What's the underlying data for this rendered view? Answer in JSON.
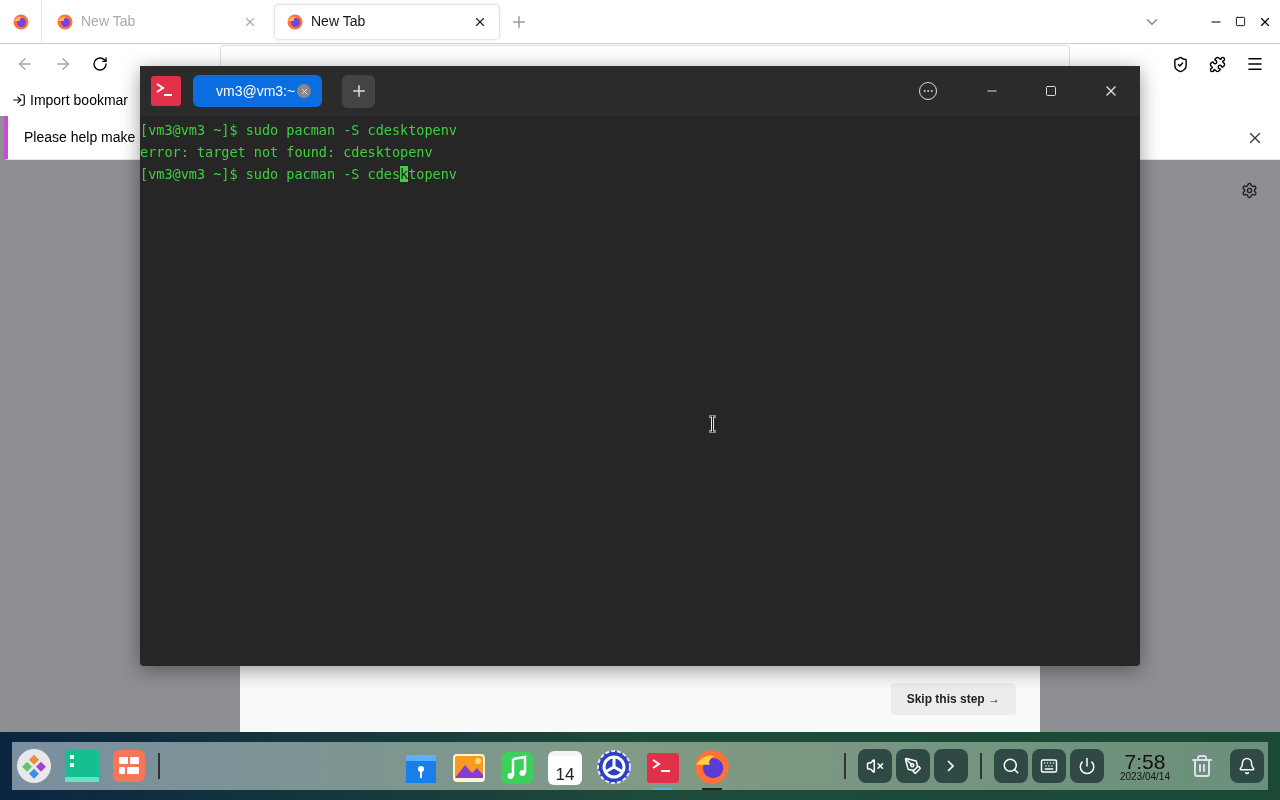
{
  "browser": {
    "tabs": [
      {
        "label": "New Tab",
        "selected": false
      },
      {
        "label": "New Tab",
        "selected": true
      }
    ],
    "bookmarks": [
      {
        "label": "Import bookmar"
      }
    ],
    "notice": {
      "text": "Please help make"
    },
    "skip_button": {
      "label": "Skip this step →"
    }
  },
  "terminal": {
    "tabs": [
      {
        "label": "vm3@vm3:~",
        "selected": true
      }
    ],
    "lines": [
      {
        "text": "[vm3@vm3 ~]$ sudo pacman -S cdesktopenv"
      },
      {
        "text": "error: target not found: cdesktopenv"
      },
      {
        "text_before_cursor": "[vm3@vm3 ~]$ sudo pacman -S cdes",
        "cursor_char": "k",
        "text_after_cursor": "topenv"
      }
    ]
  },
  "dock": {
    "left": [
      {
        "kind": "launcher"
      },
      {
        "kind": "files-green"
      },
      {
        "kind": "multitask"
      }
    ],
    "apps": [
      {
        "kind": "file-manager",
        "running": false
      },
      {
        "kind": "photos",
        "running": false
      },
      {
        "kind": "music",
        "running": false
      },
      {
        "kind": "calendar",
        "label": "14",
        "running": false
      },
      {
        "kind": "settings",
        "running": false
      },
      {
        "kind": "terminal",
        "running": true
      },
      {
        "kind": "firefox",
        "running": true
      }
    ],
    "tray": [
      {
        "kind": "mute"
      },
      {
        "kind": "pen"
      },
      {
        "kind": "chevron"
      }
    ],
    "tray2": [
      {
        "kind": "search"
      },
      {
        "kind": "keyboard"
      },
      {
        "kind": "power"
      }
    ],
    "clock": {
      "time": "7:58",
      "date": "2023/04/14"
    }
  }
}
